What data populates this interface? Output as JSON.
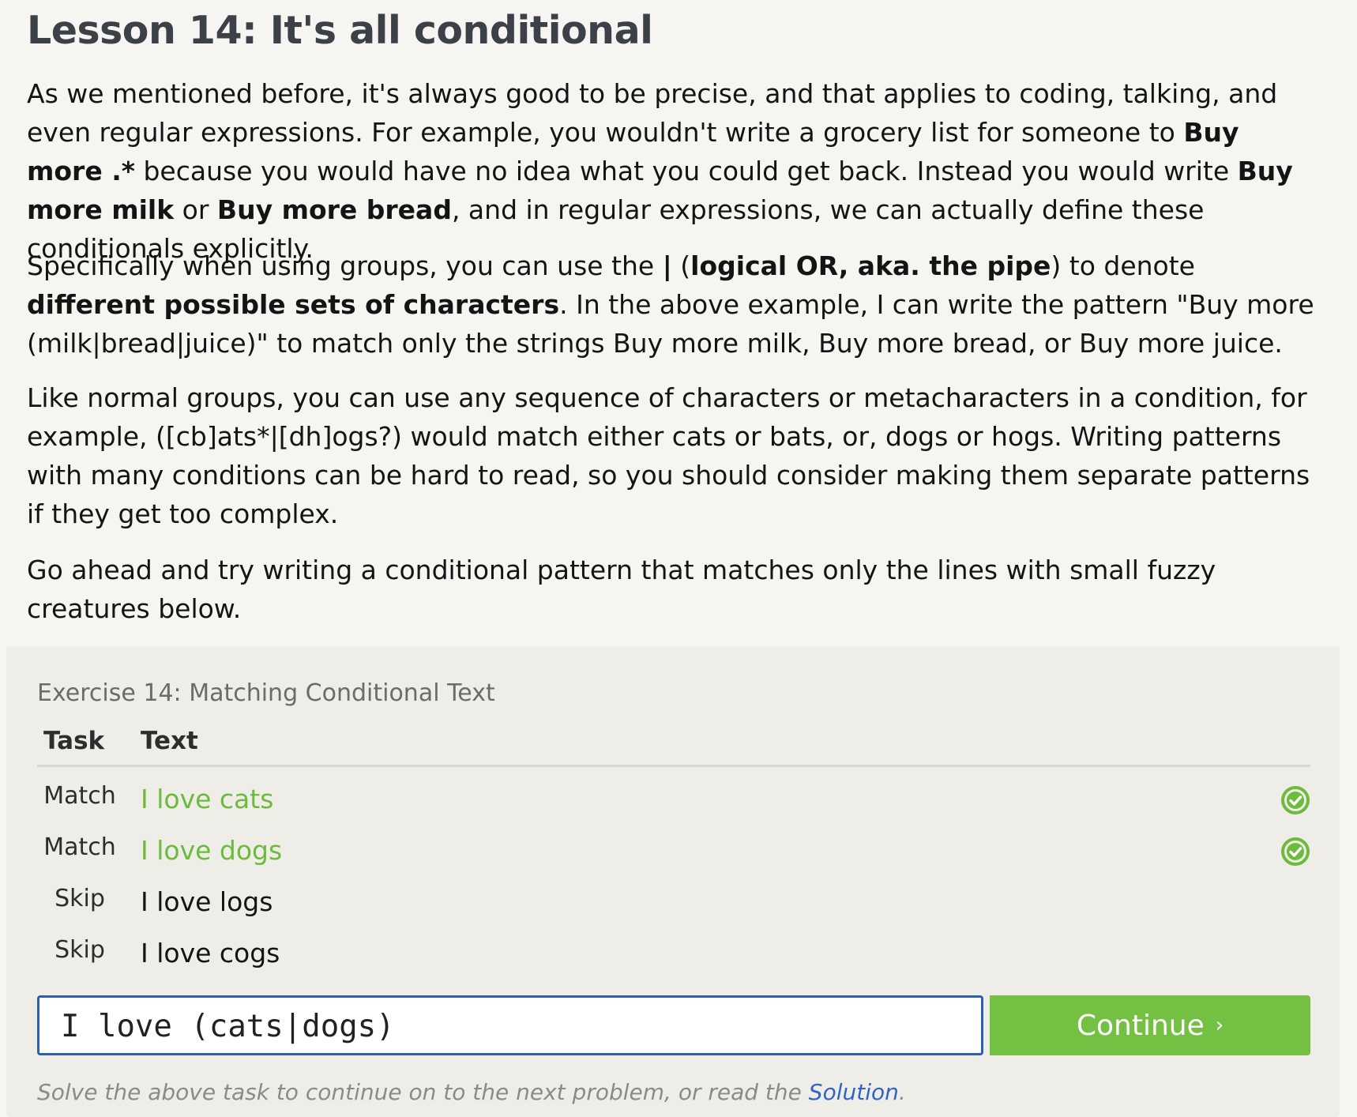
{
  "lesson": {
    "title": "Lesson 14: It's all conditional",
    "paragraphs": [
      {
        "parts": [
          {
            "t": "As we mentioned before, it's always good to be precise, and that applies to coding, talking, and even regular expressions. For example, you wouldn't write a grocery list for someone to ",
            "b": false
          },
          {
            "t": "Buy more .*",
            "b": true
          },
          {
            "t": " because you would have no idea what you could get back. Instead you would write ",
            "b": false
          },
          {
            "t": "Buy more milk",
            "b": true
          },
          {
            "t": " or ",
            "b": false
          },
          {
            "t": "Buy more bread",
            "b": true
          },
          {
            "t": ", and in regular expressions, we can actually define these conditionals explicitly.",
            "b": false
          }
        ]
      },
      {
        "parts": [
          {
            "t": "Specifically when using groups, you can use the ",
            "b": false
          },
          {
            "t": "|",
            "b": true
          },
          {
            "t": " (",
            "b": false
          },
          {
            "t": "logical OR, aka. the pipe",
            "b": true
          },
          {
            "t": ") to denote ",
            "b": false
          },
          {
            "t": "different possible sets of characters",
            "b": true
          },
          {
            "t": ". In the above example, I can write the pattern \"Buy more (milk|bread|juice)\" to match only the strings Buy more milk, Buy more bread, or Buy more juice.",
            "b": false
          }
        ]
      },
      {
        "parts": [
          {
            "t": "Like normal groups, you can use any sequence of characters or metacharacters in a condition, for example, ([cb]ats*|[dh]ogs?) would match either cats or bats, or, dogs or hogs. Writing patterns with many conditions can be hard to read, so you should consider making them separate patterns if they get too complex.",
            "b": false
          }
        ]
      },
      {
        "parts": [
          {
            "t": "Go ahead and try writing a conditional pattern that matches only the lines with small fuzzy creatures below.",
            "b": false
          }
        ]
      }
    ]
  },
  "exercise": {
    "title": "Exercise 14: Matching Conditional Text",
    "headers": {
      "task": "Task",
      "text": "Text"
    },
    "rows": [
      {
        "task": "Match",
        "text": "I love cats",
        "matched": true
      },
      {
        "task": "Match",
        "text": "I love dogs",
        "matched": true
      },
      {
        "task": "Skip",
        "text": "I love logs",
        "matched": false
      },
      {
        "task": "Skip",
        "text": "I love cogs",
        "matched": false
      }
    ],
    "input_value": "I love (cats|dogs)",
    "continue_label": "Continue",
    "continue_chevron": "›",
    "footnote_prefix": "Solve the above task to continue on to the next problem, or read the ",
    "footnote_link": "Solution",
    "footnote_suffix": "."
  },
  "colors": {
    "matched_text": "#6cbb3c",
    "button": "#74c043",
    "input_border": "#2f5fb3",
    "link": "#2f64c5"
  }
}
